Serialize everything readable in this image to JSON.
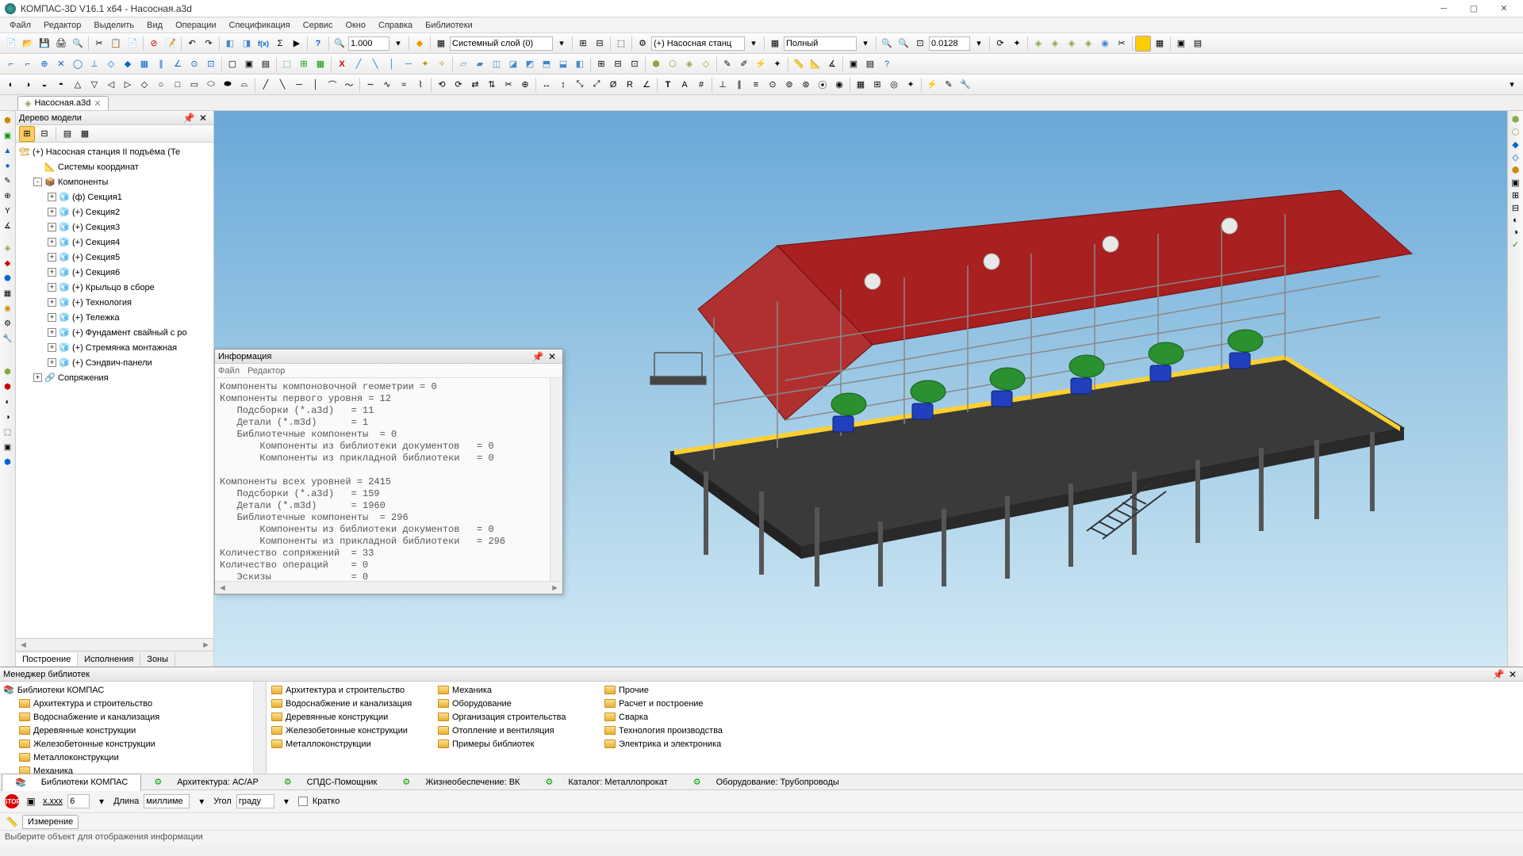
{
  "title": "КОМПАС-3D V16.1 x64 - Насосная.a3d",
  "menu": [
    "Файл",
    "Редактор",
    "Выделить",
    "Вид",
    "Операции",
    "Спецификация",
    "Сервис",
    "Окно",
    "Справка",
    "Библиотеки"
  ],
  "toolbar1": {
    "scale_value": "1.000",
    "layer_value": "Системный слой (0)",
    "config_value": "(+) Насосная станц",
    "display_value": "Полный",
    "precision_value": "0.0128"
  },
  "doc_tab": {
    "label": "Насосная.a3d"
  },
  "tree": {
    "title": "Дерево модели",
    "root": "(+) Насосная станция II подъёма (Те",
    "nodes": [
      {
        "exp": "",
        "ico": "📐",
        "label": "Системы координат",
        "indent": 1
      },
      {
        "exp": "-",
        "ico": "📦",
        "label": "Компоненты",
        "indent": 1
      },
      {
        "exp": "+",
        "ico": "🧊",
        "label": "(ф) Секция1",
        "indent": 2
      },
      {
        "exp": "+",
        "ico": "🧊",
        "label": "(+) Секция2",
        "indent": 2
      },
      {
        "exp": "+",
        "ico": "🧊",
        "label": "(+) Секция3",
        "indent": 2
      },
      {
        "exp": "+",
        "ico": "🧊",
        "label": "(+) Секция4",
        "indent": 2
      },
      {
        "exp": "+",
        "ico": "🧊",
        "label": "(+) Секция5",
        "indent": 2
      },
      {
        "exp": "+",
        "ico": "🧊",
        "label": "(+) Секция6",
        "indent": 2
      },
      {
        "exp": "+",
        "ico": "🧊",
        "label": "(+) Крыльцо в сборе",
        "indent": 2
      },
      {
        "exp": "+",
        "ico": "🧊",
        "label": "(+) Технология",
        "indent": 2
      },
      {
        "exp": "+",
        "ico": "🧊",
        "label": "(+) Тележка",
        "indent": 2
      },
      {
        "exp": "+",
        "ico": "🧊",
        "label": "(+) Фундамент свайный с ро",
        "indent": 2
      },
      {
        "exp": "+",
        "ico": "🧊",
        "label": "(+) Стремянка монтажная",
        "indent": 2
      },
      {
        "exp": "+",
        "ico": "🧊",
        "label": "(+) Сэндвич-панели",
        "indent": 2
      },
      {
        "exp": "+",
        "ico": "🔗",
        "label": "Сопряжения",
        "indent": 1
      }
    ],
    "tabs": [
      "Построение",
      "Исполнения",
      "Зоны"
    ]
  },
  "info": {
    "title": "Информация",
    "menu": [
      "Файл",
      "Редактор"
    ],
    "text": "Компоненты компоновочной геометрии = 0\nКомпоненты первого уровня = 12\n   Подсборки (*.a3d)   = 11\n   Детали (*.m3d)      = 1\n   Библиотечные компоненты  = 0\n       Компоненты из библиотеки документов   = 0\n       Компоненты из прикладной библиотеки   = 0\n\nКомпоненты всех уровней = 2415\n   Подсборки (*.a3d)   = 159\n   Детали (*.m3d)      = 1960\n   Библиотечные компоненты  = 296\n       Компоненты из библиотеки документов   = 0\n       Компоненты из прикладной библиотеки   = 296\nКоличество сопряжений  = 33\nКоличество операций    = 0\n   Эскизы              = 0"
  },
  "lib": {
    "title": "Менеджер библиотек",
    "root": "Библиотеки КОМПАС",
    "tree_items": [
      "Архитектура и строительство",
      "Водоснабжение и канализация",
      "Деревянные конструкции",
      "Железобетонные конструкции",
      "Металлоконструкции",
      "Механика"
    ],
    "cols": [
      [
        "Архитектура и строительство",
        "Водоснабжение и канализация",
        "Деревянные конструкции",
        "Железобетонные конструкции",
        "Металлоконструкции"
      ],
      [
        "Механика",
        "Оборудование",
        "Организация строительства",
        "Отопление и вентиляция",
        "Примеры библиотек"
      ],
      [
        "Прочие",
        "Расчет и построение",
        "Сварка",
        "Технология производства",
        "Электрика и электроника"
      ]
    ],
    "tabs": [
      "Библиотеки КОМПАС",
      "Архитектура: АС/АР",
      "СПДС-Помощник",
      "Жизнеобеспечение: ВК",
      "Каталог: Металлопрокат",
      "Оборудование: Трубопроводы"
    ]
  },
  "status": {
    "prec_label": "x.xxx",
    "prec_val": "6",
    "len_label": "Длина",
    "len_unit": "миллиме",
    "ang_label": "Угол",
    "ang_unit": "граду",
    "short_label": "Кратко",
    "measure_label": "Измерение",
    "msg": "Выберите объект для отображения информации"
  }
}
